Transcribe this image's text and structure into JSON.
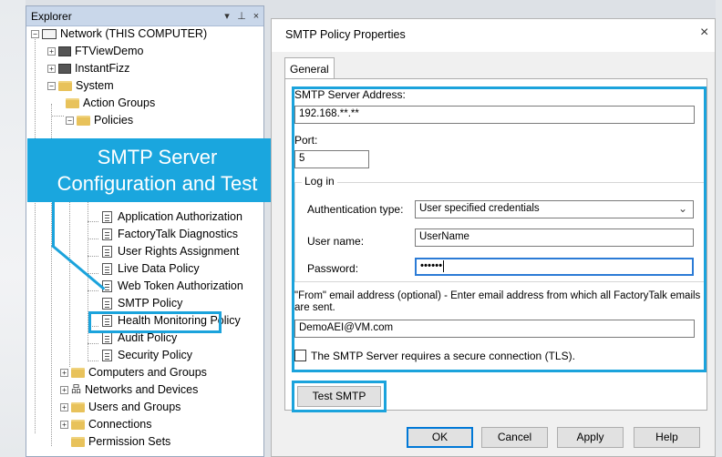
{
  "explorer": {
    "title": "Explorer",
    "controls": {
      "dropdown": "▾",
      "pin": "⊥",
      "close": "×"
    },
    "tree": {
      "network": "Network (THIS COMPUTER)",
      "ftviewdemo": "FTViewDemo",
      "instantfizz": "InstantFizz",
      "system": "System",
      "action_groups": "Action Groups",
      "policies": "Policies",
      "application_authorization": "Application Authorization",
      "factorytalk_diagnostics": "FactoryTalk Diagnostics",
      "user_rights_assignment": "User Rights Assignment",
      "live_data_policy": "Live Data Policy",
      "web_token_authorization": "Web Token Authorization",
      "smtp_policy": "SMTP Policy",
      "health_monitoring_policy": "Health Monitoring Policy",
      "audit_policy": "Audit Policy",
      "security_policy": "Security Policy",
      "computers_and_groups": "Computers and Groups",
      "networks_and_devices": "Networks and Devices",
      "users_and_groups": "Users and Groups",
      "connections": "Connections",
      "permission_sets": "Permission Sets"
    }
  },
  "callout": {
    "line1": "SMTP Server",
    "line2": "Configuration and Test"
  },
  "dialog": {
    "title": "SMTP Policy Properties",
    "close": "×",
    "tab_general": "General",
    "smtp_server_label": "SMTP Server Address:",
    "smtp_server_value": "192.168.**.**",
    "port_label": "Port:",
    "port_value": "5",
    "login_group": "Log in",
    "auth_type_label": "Authentication type:",
    "auth_type_value": "User specified credentials",
    "username_label": "User name:",
    "username_value": "UserName",
    "password_label": "Password:",
    "password_value": "••••••",
    "from_label": "\"From\" email address (optional) - Enter email address from which all FactoryTalk emails are sent.",
    "from_value": "DemoAEI@VM.com",
    "tls_label": "The SMTP Server requires a secure connection (TLS).",
    "tls_checked": false,
    "test_smtp": "Test SMTP",
    "ok": "OK",
    "cancel": "Cancel",
    "apply": "Apply",
    "help": "Help"
  },
  "colors": {
    "highlight": "#1ba3dc",
    "callout_bg": "#1aa6de",
    "explorer_header": "#c9d7ea"
  }
}
